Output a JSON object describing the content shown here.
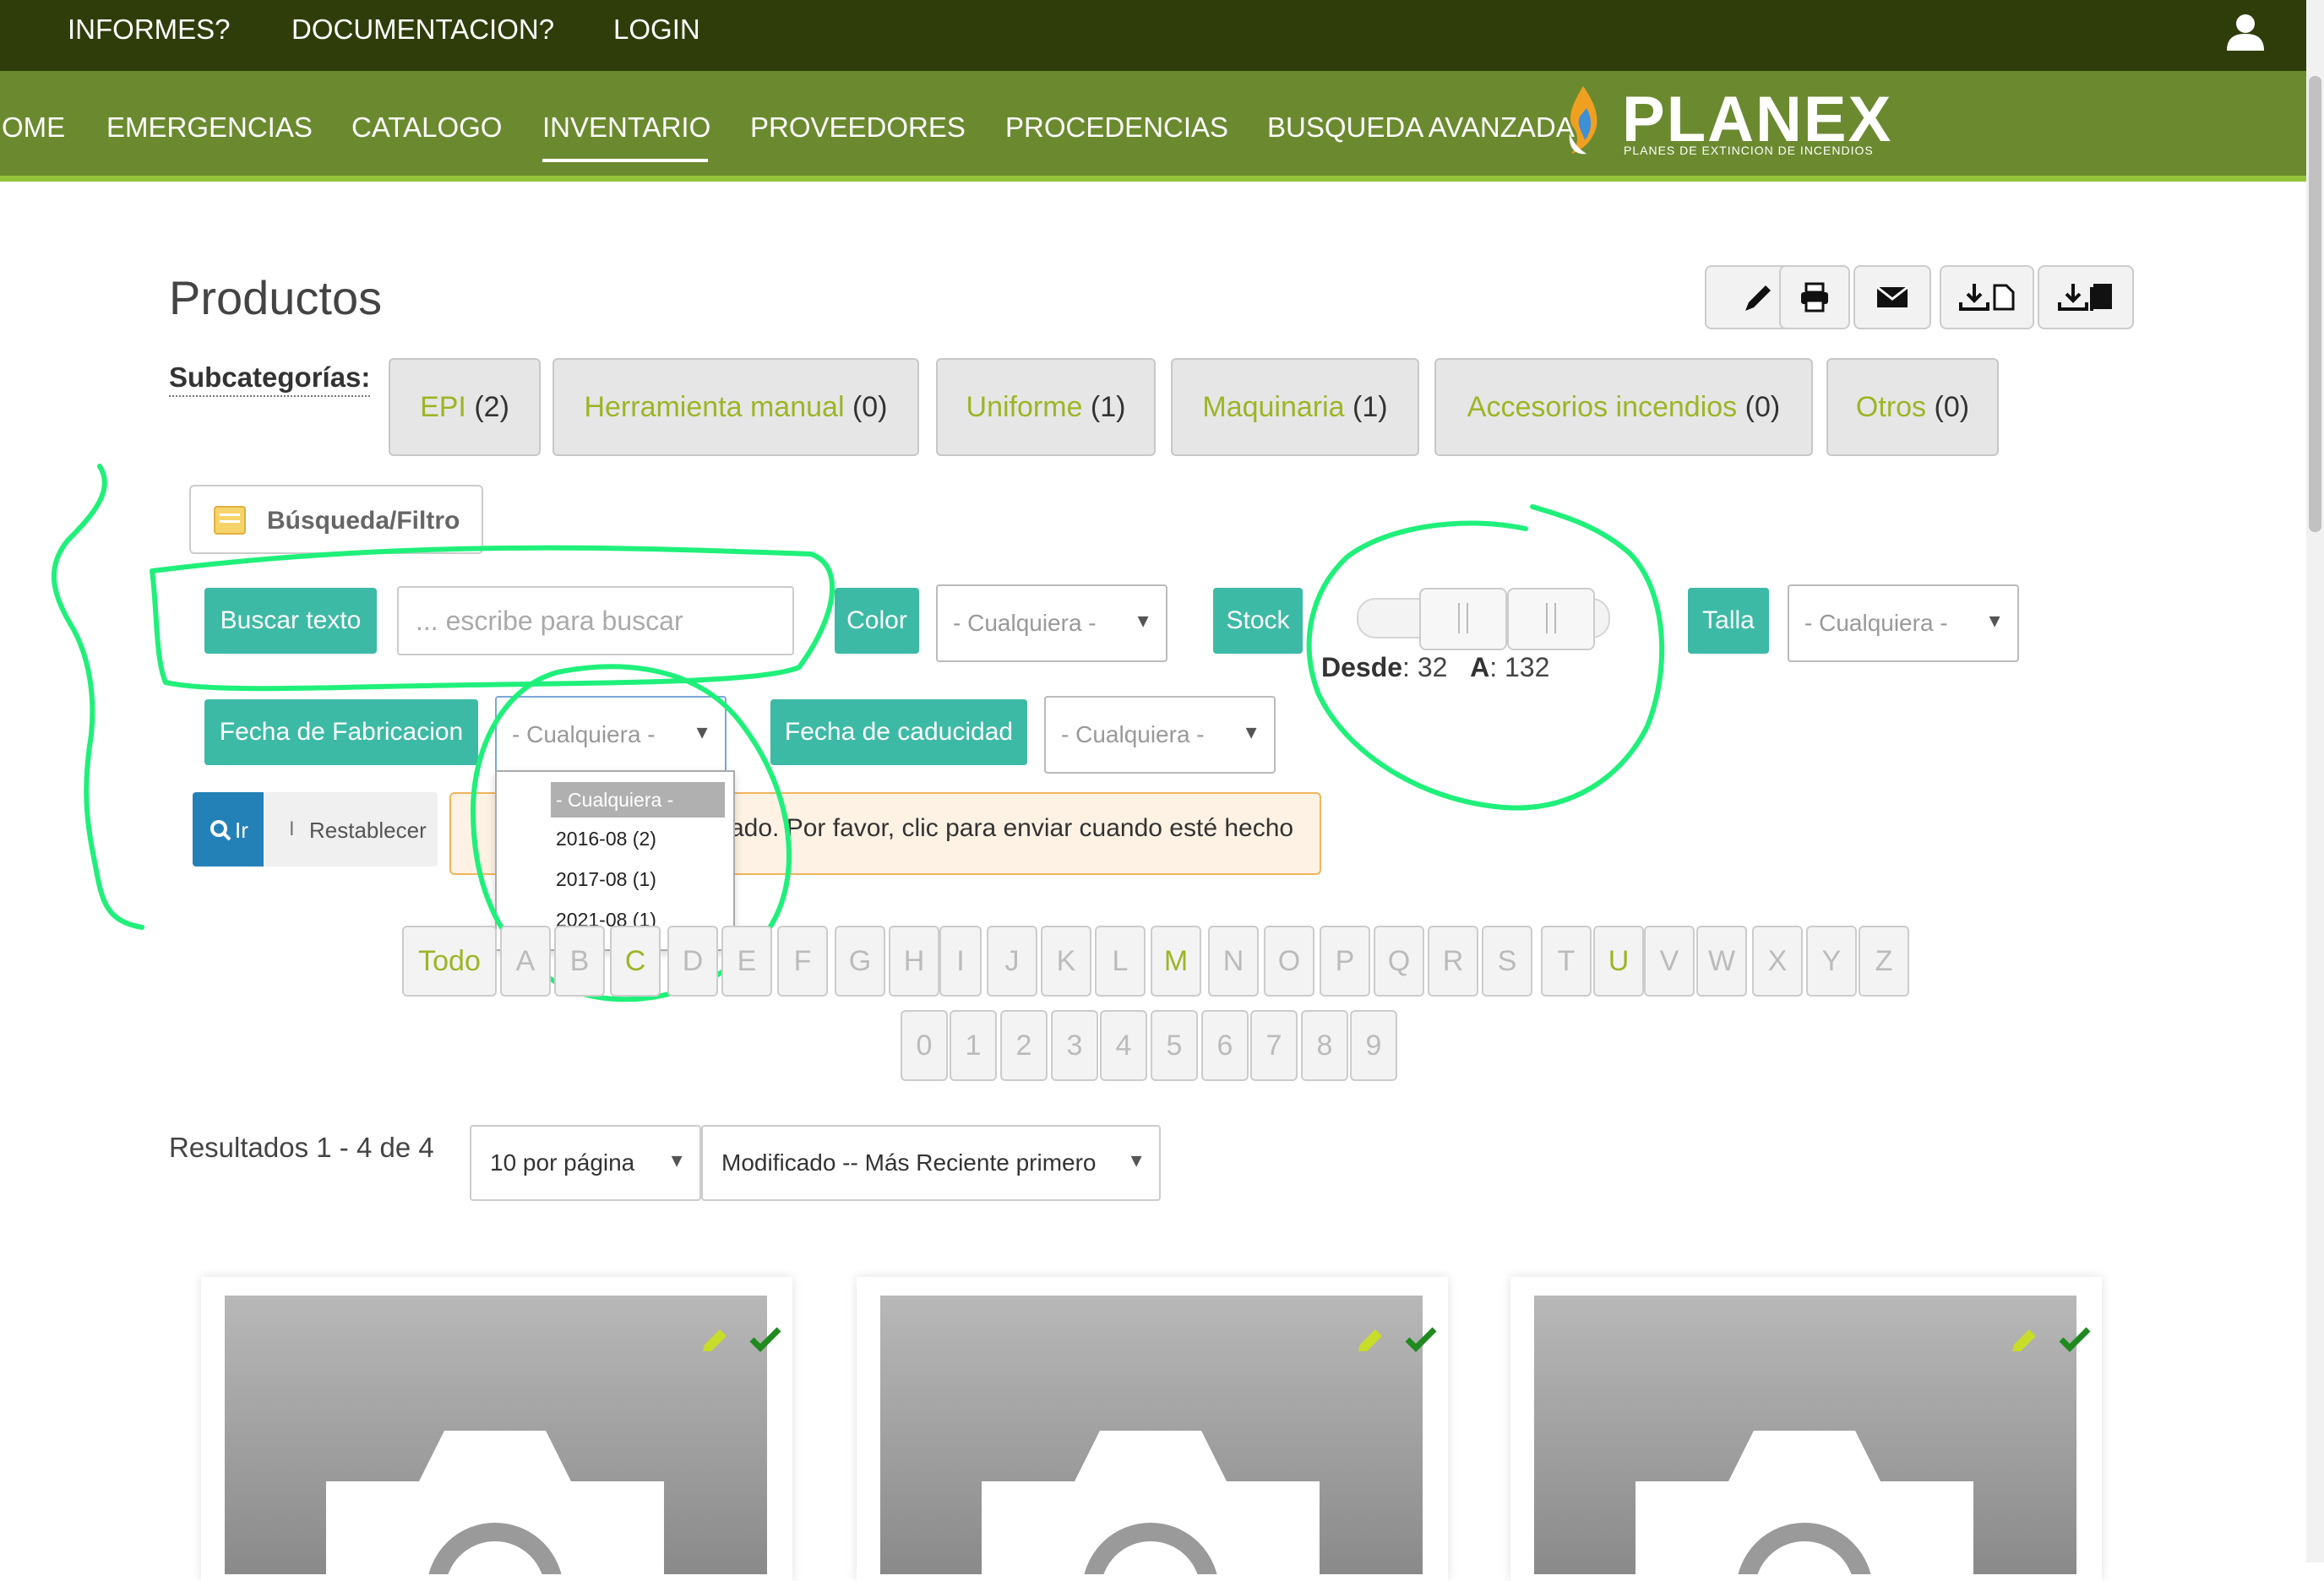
{
  "topbar": {
    "informes": "INFORMES?",
    "documentacion": "DOCUMENTACION?",
    "login": "LOGIN"
  },
  "nav": {
    "items": [
      "OME",
      "EMERGENCIAS",
      "CATALOGO",
      "INVENTARIO",
      "PROVEEDORES",
      "PROCEDENCIAS",
      "BUSQUEDA AVANZADA"
    ],
    "active": "INVENTARIO"
  },
  "logo": {
    "name": "PLANEX",
    "tagline": "PLANES DE EXTINCION DE INCENDIOS"
  },
  "page": {
    "title": "Productos"
  },
  "toolbar": {
    "icons": [
      "edit-icon",
      "print-icon",
      "mail-icon",
      "export-doc-icon",
      "export-book-icon"
    ]
  },
  "subcategories": {
    "label": "Subcategorías",
    "items": [
      {
        "name": "EPI",
        "count": "(2)"
      },
      {
        "name": "Herramienta manual",
        "count": "(0)"
      },
      {
        "name": "Uniforme",
        "count": "(1)"
      },
      {
        "name": "Maquinaria",
        "count": "(1)"
      },
      {
        "name": "Accesorios incendios",
        "count": "(0)"
      },
      {
        "name": "Otros",
        "count": "(0)"
      }
    ]
  },
  "filter": {
    "toggle_label": "Búsqueda/Filtro",
    "search_label": "Buscar texto",
    "search_placeholder": "... escribe para buscar",
    "color_label": "Color",
    "color_value": "- Cualquiera -",
    "stock_label": "Stock",
    "stock_from_label": "Desde",
    "stock_from": "32",
    "stock_to_label": "A",
    "stock_to": "132",
    "talla_label": "Talla",
    "talla_value": "- Cualquiera -",
    "fab_label": "Fecha de Fabricacion",
    "fab_value": "- Cualquiera -",
    "cad_label": "Fecha de caducidad",
    "cad_value": "- Cualquiera -",
    "go_label": "Ir",
    "reset_label": "Restablecer",
    "notice": "ado. Por favor, clic para enviar cuando esté hecho"
  },
  "fab_dropdown": {
    "options": [
      "- Cualquiera -",
      "2016-08 (2)",
      "2017-08 (1)",
      "2021-08 (1)"
    ],
    "selected": "- Cualquiera -"
  },
  "alphabet": {
    "all": "Todo",
    "letters": [
      "A",
      "B",
      "C",
      "D",
      "E",
      "F",
      "G",
      "H",
      "I",
      "J",
      "K",
      "L",
      "M",
      "N",
      "O",
      "P",
      "Q",
      "R",
      "S",
      "T",
      "U",
      "V",
      "W",
      "X",
      "Y",
      "Z"
    ],
    "active_letters": [
      "C",
      "M",
      "U"
    ],
    "digits": [
      "0",
      "1",
      "2",
      "3",
      "4",
      "5",
      "6",
      "7",
      "8",
      "9"
    ]
  },
  "results": {
    "text": "Resultados 1 - 4 de 4",
    "per_page": "10 por página",
    "sort": "Modificado -- Más Reciente primero"
  },
  "colors": {
    "topbar": "#2f3d0a",
    "navbar": "#6b8a30",
    "accent": "#3dbaa5",
    "link_green": "#9cb526",
    "annotation": "#1ff07a"
  }
}
